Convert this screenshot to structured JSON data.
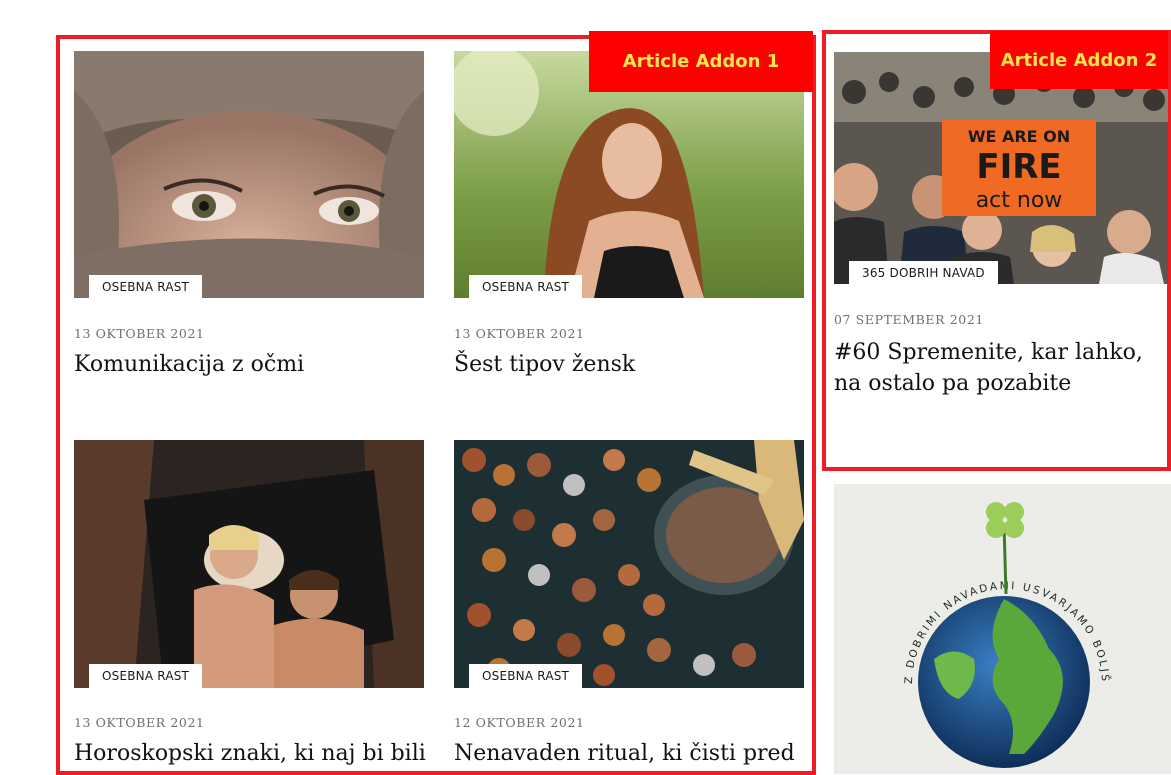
{
  "addon_labels": {
    "addon1": "Article Addon 1",
    "addon2": "Article Addon 2"
  },
  "addon1": {
    "articles": [
      {
        "category": "OSEBNA RAST",
        "date": "13 OKTOBER 2021",
        "title": "Komunikacija z očmi",
        "image": "woman-eyes-veil-photo"
      },
      {
        "category": "OSEBNA RAST",
        "date": "13 OKTOBER 2021",
        "title": "Šest tipov žensk",
        "image": "woman-in-grass-photo"
      },
      {
        "category": "OSEBNA RAST",
        "date": "13 OKTOBER 2021",
        "title": "Horoskopski znaki, ki naj bi bili",
        "image": "couple-with-dog-photo"
      },
      {
        "category": "OSEBNA RAST",
        "date": "12 OKTOBER 2021",
        "title": "Nenavaden ritual, ki čisti pred",
        "image": "coins-jar-photo"
      }
    ]
  },
  "addon2": {
    "article": {
      "category": "365 DOBRIH NAVAD",
      "date": "07 SEPTEMBER 2021",
      "title": "#60 Spremenite, kar lahko, na ostalo pa pozabite",
      "image": "climate-protest-photo",
      "sign_lines": [
        "WE ARE ON",
        "FIRE",
        "act now"
      ]
    }
  },
  "banner": {
    "circle_text": "Z DOBRIMI NAVADAMI USVARJAMO BOLJŠI SVET",
    "image": "earth-clover-graphic"
  },
  "colors": {
    "frame": "#ee1c25",
    "label_bg": "#ff0000",
    "label_text": "#f6e84a"
  }
}
